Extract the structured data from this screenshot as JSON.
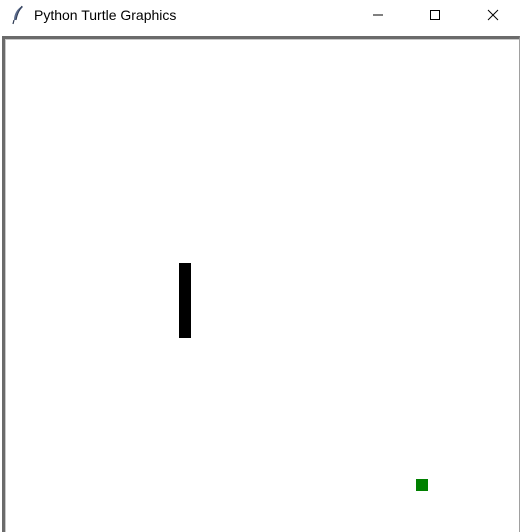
{
  "window": {
    "title": "Python Turtle Graphics",
    "icon": "feather-icon",
    "controls": {
      "minimize": "minimize-icon",
      "maximize": "maximize-icon",
      "close": "close-icon"
    }
  },
  "canvas": {
    "background": "#ffffff",
    "shapes": [
      {
        "name": "paddle",
        "color": "#000000"
      },
      {
        "name": "food",
        "color": "#008000"
      }
    ]
  }
}
